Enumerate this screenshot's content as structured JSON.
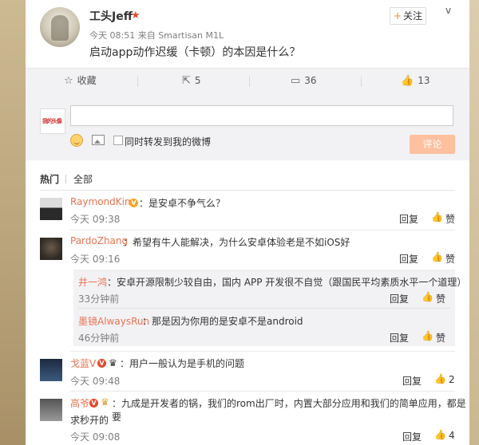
{
  "post": {
    "username": "工头Jeff",
    "meta": "今天 08:51 来自 Smartisan M1L",
    "text": "启动app动作迟缓（卡顿）的本因是什么？",
    "follow_label": "关注",
    "chevron": "v"
  },
  "actions": {
    "favorite": "收藏",
    "repost": "5",
    "comment": "36",
    "like": "13"
  },
  "comment_form": {
    "placeholder": "",
    "repost_label": "同时转发到我的微博",
    "submit_label": "评论",
    "my_avatar_text": "我的头像"
  },
  "tabs": {
    "hot": "热门",
    "all": "全部"
  },
  "comments": [
    {
      "name": "RaymondKim",
      "text": "：是安卓不争气么？",
      "time": "今天 09:38",
      "reply": "回复",
      "like": "赞"
    },
    {
      "name": "PardoZhang",
      "text": "：希望有牛人能解决，为什么安卓体验老是不如iOS好",
      "time": "今天 09:16",
      "reply": "回复",
      "like": "赞"
    },
    {
      "name": "戈蓝V",
      "text": "：用户一般认为是手机的问题",
      "time": "今天 09:48",
      "reply": "回复",
      "like": "2"
    },
    {
      "name": "高爷",
      "text_line1": "：九成是开发者的锅，我们的rom出厂时，内置大部分应用和我们的简单应用，都是要",
      "text_line2": "求秒开的",
      "time": "今天 09:08",
      "reply": "回复",
      "like": "4"
    }
  ],
  "replies": [
    {
      "name": "井一鸿",
      "text": "：安卓开源限制少较自由，国内 APP 开发很不自觉（跟国民平均素质水平一个道理）",
      "time": "33分钟前",
      "reply": "回复",
      "like": "赞"
    },
    {
      "name": "墨镜AlwaysRun",
      "text": "：那是因为你用的是安卓不是android",
      "time": "46分钟前",
      "reply": "回复",
      "like": "赞"
    }
  ],
  "colors": {
    "accent_orange": "#eb7350",
    "submit_bg": "#ffc09f",
    "action_bar_bg": "#f2f2f5"
  }
}
